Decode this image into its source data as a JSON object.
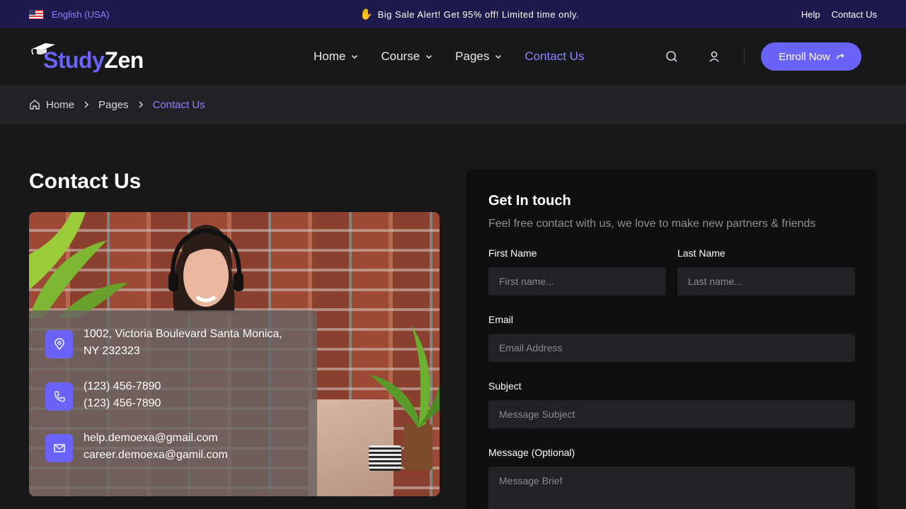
{
  "topbar": {
    "language": "English (USA)",
    "promo": "Big Sale Alert! Get 95% off! Limited time only.",
    "links": [
      "Help",
      "Contact Us"
    ]
  },
  "header": {
    "logo_part1": "Study",
    "logo_part2": "Zen",
    "nav": [
      {
        "label": "Home",
        "has_dropdown": true
      },
      {
        "label": "Course",
        "has_dropdown": true
      },
      {
        "label": "Pages",
        "has_dropdown": true
      },
      {
        "label": "Contact Us",
        "has_dropdown": false,
        "active": true
      }
    ],
    "enroll_label": "Enroll Now"
  },
  "breadcrumb": [
    "Home",
    "Pages",
    "Contact Us"
  ],
  "page": {
    "title": "Contact Us"
  },
  "contact_info": {
    "address_line1": "1002, Victoria Boulevard Santa Monica,",
    "address_line2": "NY 232323",
    "phone1": "(123) 456-7890",
    "phone2": "(123) 456-7890",
    "email1": "help.demoexa@gmail.com",
    "email2": "career.demoexa@gamil.com"
  },
  "form": {
    "title": "Get In touch",
    "subtitle": "Feel free contact with us, we love to make new partners & friends",
    "first_name_label": "First Name",
    "first_name_placeholder": "First name...",
    "last_name_label": "Last Name",
    "last_name_placeholder": "Last name...",
    "email_label": "Email",
    "email_placeholder": "Email Address",
    "subject_label": "Subject",
    "subject_placeholder": "Message Subject",
    "message_label": "Message (Optional)",
    "message_placeholder": "Message Brief"
  },
  "colors": {
    "accent": "#6b63f7",
    "topbar_bg": "#1e1a4d",
    "page_bg": "#18181b",
    "form_bg": "#0f0f10",
    "input_bg": "#222226"
  }
}
